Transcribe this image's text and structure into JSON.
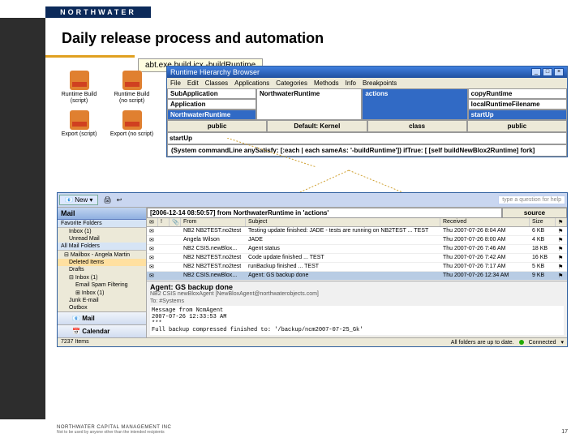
{
  "brand": "NORTHWATER",
  "slide_title": "Daily release process and automation",
  "batch_command": "abt.exe build.icx -buildRuntime",
  "desktop_icons": [
    {
      "label": "Runtime Build (script)"
    },
    {
      "label": "Runtime Build (no script)"
    },
    {
      "label": "Export (script)"
    },
    {
      "label": "Export (no script)"
    }
  ],
  "hierarchy": {
    "title": "Runtime Hierarchy Browser",
    "menu": [
      "File",
      "Edit",
      "Classes",
      "Applications",
      "Categories",
      "Methods",
      "Info",
      "Breakpoints"
    ],
    "col1_header": "SubApplication",
    "col1_rows": [
      "Application",
      "NorthwaterRuntime"
    ],
    "col2_header": "NorthwaterRuntime",
    "col3_header": "actions",
    "col4_rows": [
      "copyRuntime",
      "localRuntimeFilename",
      "startUp"
    ],
    "row2": [
      "public",
      "Default: Kernel",
      "class",
      "public"
    ],
    "startup": "startUp",
    "code": "(System commandLine anySatisfy: [:each | each sameAs: '-buildRuntime']) ifTrue: [ [self buildNewBlox2Runtime] fork]"
  },
  "outlook": {
    "new_label": "New",
    "help_placeholder": "type a question for help",
    "mail_header": "Mail",
    "fav_header": "Favorite Folders",
    "fav_items": [
      "Inbox (1)",
      "Unread Mail"
    ],
    "all_header": "All Mail Folders",
    "mailbox": "Mailbox - Angela Martin",
    "folders": [
      "Deleted Items",
      "Drafts",
      "Inbox (1)",
      "Email Spam Filtering",
      "Inbox (1)",
      "Junk E-mail",
      "Outbox"
    ],
    "nav_buttons": [
      "Mail",
      "Calendar"
    ],
    "source_path": "[2006-12-14 08:50:57] from NorthwaterRuntime in 'actions'",
    "source_label": "source",
    "columns": {
      "from": "From",
      "subject": "Subject",
      "received": "Received",
      "size": "Size"
    },
    "rows": [
      {
        "from": "NB2 NB2TEST.no2test",
        "subject": "Testing update finished: JADE - tests are running on NB2TEST ... TEST",
        "received": "Thu 2007-07-26 8:04 AM",
        "size": "6 KB"
      },
      {
        "from": "Angela Wilson",
        "subject": "JADE",
        "received": "Thu 2007-07-26 8:00 AM",
        "size": "4 KB"
      },
      {
        "from": "NB2 CSIS.newBlox...",
        "subject": "Agent status",
        "received": "Thu 2007-07-26 7:46 AM",
        "size": "18 KB"
      },
      {
        "from": "NB2 NB2TEST.no2test",
        "subject": "Code update finished ... TEST",
        "received": "Thu 2007-07-26 7:42 AM",
        "size": "16 KB"
      },
      {
        "from": "NB2 NB2TEST.no2test",
        "subject": "runBackup finished ... TEST",
        "received": "Thu 2007-07-26 7:17 AM",
        "size": "5 KB"
      },
      {
        "from": "NB2 CSIS.newBlox...",
        "subject": "Agent: GS backup done",
        "received": "Thu 2007-07-26 12:34 AM",
        "size": "9 KB"
      }
    ],
    "preview": {
      "subject": "Agent: GS backup done",
      "from": "NB2 CSIS newBloxAgent [NewBloxAgent@northwaterobjects.com]",
      "to": "To: #Systems",
      "body": "Message from NcmAgent\n2007-07-26 12:33:53 AM\n***\nFull backup compressed finished to: '/backup/ncm2007-07-25_Gk'"
    },
    "status_left": "7237 Items",
    "status_mid": "All folders are up to date.",
    "status_right": "Connected"
  },
  "footer": {
    "company": "NORTHWATER CAPITAL MANAGEMENT INC",
    "disclaimer": "Not to be used by anyone other than the intended recipients",
    "page": "17"
  }
}
